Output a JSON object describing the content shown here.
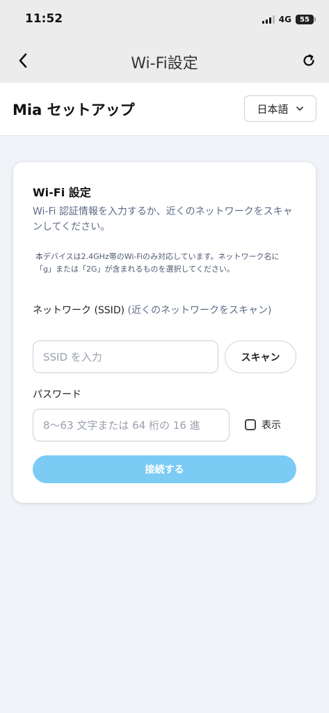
{
  "status": {
    "time": "11:52",
    "network": "4G",
    "battery": "55"
  },
  "nav": {
    "title": "Wi-Fi設定",
    "back_icon": "chevron-left-icon",
    "refresh_icon": "refresh-icon"
  },
  "header": {
    "title": "Mia セットアップ",
    "language": "日本語"
  },
  "card": {
    "title": "Wi-Fi 設定",
    "description": "Wi-Fi 認証情報を入力するか、近くのネットワークをスキャンしてください。",
    "note": "本デバイスは2.4GHz帯のWi-Fiのみ対応しています。ネットワーク名に「g」または「2G」が含まれるものを選択してください。",
    "ssid": {
      "label": "ネットワーク (SSID)",
      "hint": "(近くのネットワークをスキャン)",
      "placeholder": "SSID を入力",
      "value": "",
      "scan_button": "スキャン"
    },
    "password": {
      "label": "パスワード",
      "placeholder": "8〜63 文字または 64 桁の 16 進",
      "value": "",
      "show_label": "表示",
      "show_checked": false
    },
    "connect_button": "接続する"
  },
  "colors": {
    "accent": "#7ccbf5",
    "background": "#f0f3f7",
    "muted_text": "#5d6a85"
  }
}
